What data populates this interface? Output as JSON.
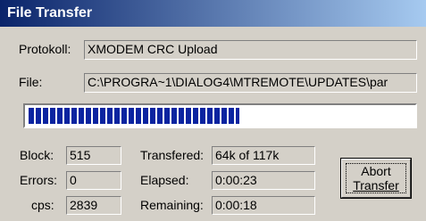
{
  "titlebar": {
    "title": "File Transfer",
    "gradient_start": "#0a246a",
    "gradient_end": "#a6caf0"
  },
  "protocol": {
    "label": "Protokoll:",
    "value": "XMODEM CRC Upload"
  },
  "file": {
    "label": "File:",
    "value": "C:\\PROGRA~1\\DIALOG4\\MTREMOTE\\UPDATES\\par"
  },
  "progress": {
    "fraction": 0.55,
    "color": "#0a24a0"
  },
  "stats": {
    "block": {
      "label": "Block:",
      "value": "515"
    },
    "errors": {
      "label": "Errors:",
      "value": "0"
    },
    "cps": {
      "label": "cps:",
      "value": "2839"
    },
    "transfered": {
      "label": "Transfered:",
      "value": "64k of 117k"
    },
    "elapsed": {
      "label": "Elapsed:",
      "value": "0:00:23"
    },
    "remaining": {
      "label": "Remaining:",
      "value": "0:00:18"
    }
  },
  "abort_button": {
    "line1": "Abort",
    "line2": "Transfer"
  }
}
